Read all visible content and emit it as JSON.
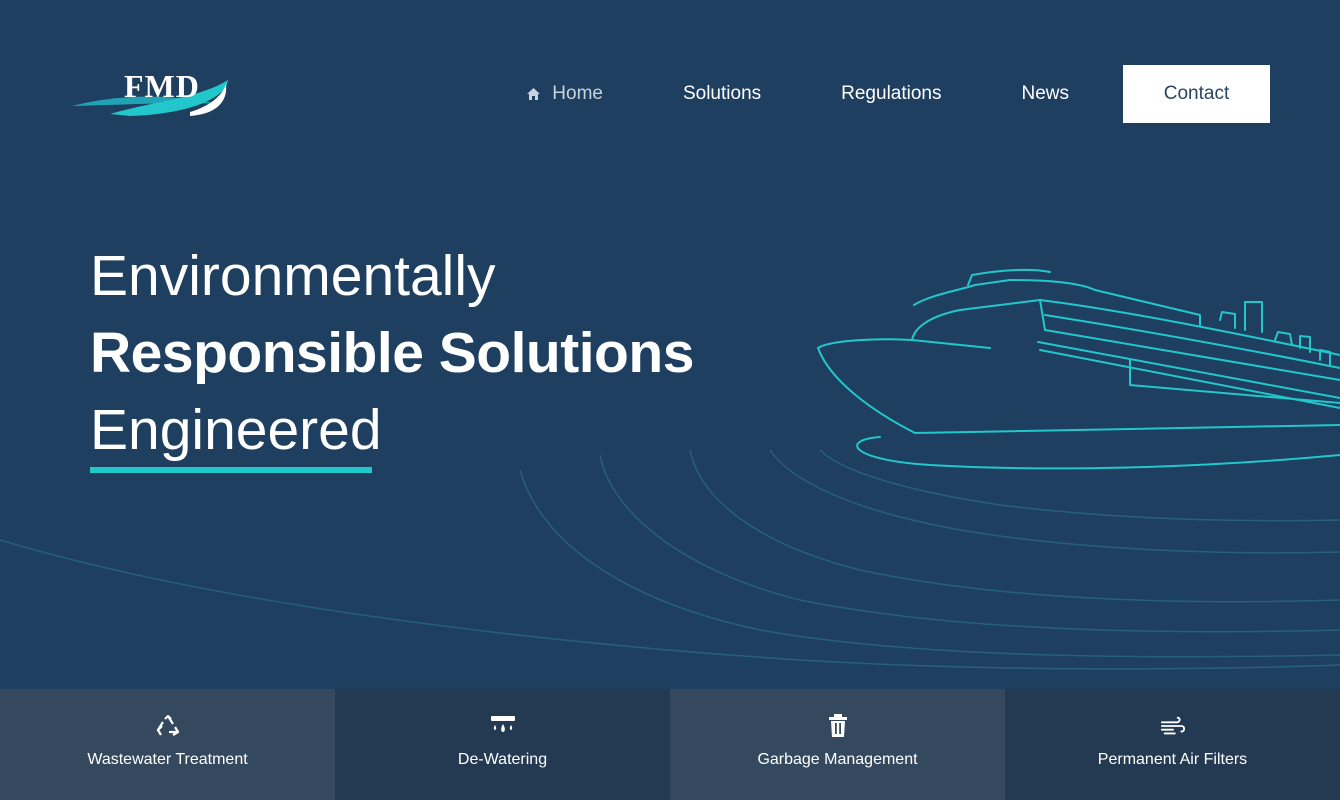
{
  "brand": {
    "logo_text": "FMD"
  },
  "nav": {
    "items": [
      {
        "label": "Home",
        "icon": "home-icon",
        "active": true
      },
      {
        "label": "Solutions"
      },
      {
        "label": "Regulations"
      },
      {
        "label": "News"
      }
    ],
    "contact_label": "Contact"
  },
  "hero": {
    "line1": "Environmentally",
    "line2": "Responsible Solutions",
    "line3": "Engineered",
    "accent_color": "#20c9c9",
    "background_color": "#1e3f5f",
    "illustration": "cruise-ship-outline"
  },
  "services": [
    {
      "label": "Wastewater Treatment",
      "icon": "recycle-icon"
    },
    {
      "label": "De-Watering",
      "icon": "water-drops-icon"
    },
    {
      "label": "Garbage Management",
      "icon": "trash-icon"
    },
    {
      "label": "Permanent Air Filters",
      "icon": "wind-icon"
    }
  ]
}
